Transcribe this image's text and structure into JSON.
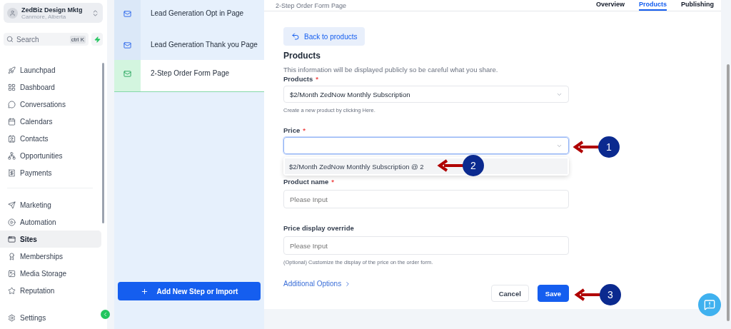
{
  "account": {
    "name": "ZedBiz Design Mktg",
    "location": "Canmore, Alberta"
  },
  "search": {
    "placeholder": "Search",
    "shortcut": "ctrl K"
  },
  "sidebar": {
    "groups": [
      [
        {
          "label": "Launchpad",
          "selected": false
        },
        {
          "label": "Dashboard",
          "selected": false
        },
        {
          "label": "Conversations",
          "selected": false
        },
        {
          "label": "Calendars",
          "selected": false
        },
        {
          "label": "Contacts",
          "selected": false
        },
        {
          "label": "Opportunities",
          "selected": false
        },
        {
          "label": "Payments",
          "selected": false
        }
      ],
      [
        {
          "label": "Marketing",
          "selected": false
        },
        {
          "label": "Automation",
          "selected": false
        },
        {
          "label": "Sites",
          "selected": true
        },
        {
          "label": "Memberships",
          "selected": false
        },
        {
          "label": "Media Storage",
          "selected": false
        },
        {
          "label": "Reputation",
          "selected": false
        }
      ]
    ],
    "settings": "Settings"
  },
  "steps": [
    {
      "label": "Lead Generation Opt in Page",
      "selected": false
    },
    {
      "label": "Lead Generation Thank you Page",
      "selected": false
    },
    {
      "label": "2-Step Order Form Page",
      "selected": true
    }
  ],
  "add_step_button": "Add New Step or Import",
  "header": {
    "title": "2-Step Order Form Page",
    "tabs": [
      {
        "label": "Overview",
        "selected": false
      },
      {
        "label": "Products",
        "selected": true
      },
      {
        "label": "Publishing",
        "selected": false
      }
    ]
  },
  "form": {
    "back_button": "Back to products",
    "title": "Products",
    "subtitle": "This information will be displayed publicly so be careful what you share.",
    "product": {
      "label": "Products",
      "required_mark": "*",
      "value": "$2/Month ZedNow Monthly Subscription",
      "hint": "Create a new product by clicking Here."
    },
    "price": {
      "label": "Price",
      "required_mark": "*",
      "expanded": true,
      "options": [
        "$2/Month ZedNow Monthly Subscription @ 2"
      ]
    },
    "product_name": {
      "label": "Product name",
      "required_mark": "*",
      "placeholder": "Please Input"
    },
    "price_override": {
      "label": "Price display override",
      "placeholder": "Please Input",
      "hint": "(Optional) Customize the display of the price on the order form."
    },
    "additional_options": "Additional Options",
    "buttons": [
      {
        "label": "Cancel",
        "kind": "secondary"
      },
      {
        "label": "Save",
        "kind": "primary"
      }
    ]
  },
  "annotations": [
    {
      "number": "1"
    },
    {
      "number": "2"
    },
    {
      "number": "3"
    }
  ]
}
